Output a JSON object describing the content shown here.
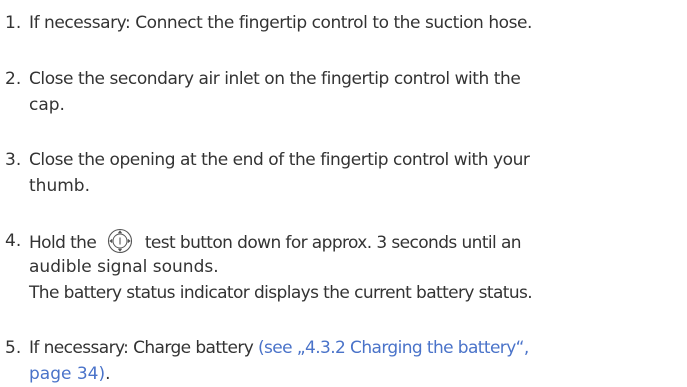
{
  "colors": {
    "text": "#333333",
    "link": "#4a73c9"
  },
  "steps": [
    {
      "number": "1.",
      "line1": "If necessary: Connect the fingertip control to the suction hose."
    },
    {
      "number": "2.",
      "line1": "Close the secondary air inlet on the fingertip control with the",
      "line2": "cap."
    },
    {
      "number": "3.",
      "line1": "Close the opening at the end of the fingertip control with your",
      "line2": "thumb."
    },
    {
      "number": "4.",
      "line1_before_icon": "Hold the",
      "icon": "test-button-icon",
      "line1_after_icon": "test button down for approx. 3 seconds until an",
      "line2": "audible signal sounds.",
      "result": "The battery status indicator displays the current battery status."
    },
    {
      "number": "5.",
      "line1_text": "If necessary: Charge battery ",
      "link_line1": "(see „4.3.2 Charging the battery“,",
      "link_line2": "page 34)",
      "line2_end": "."
    }
  ]
}
